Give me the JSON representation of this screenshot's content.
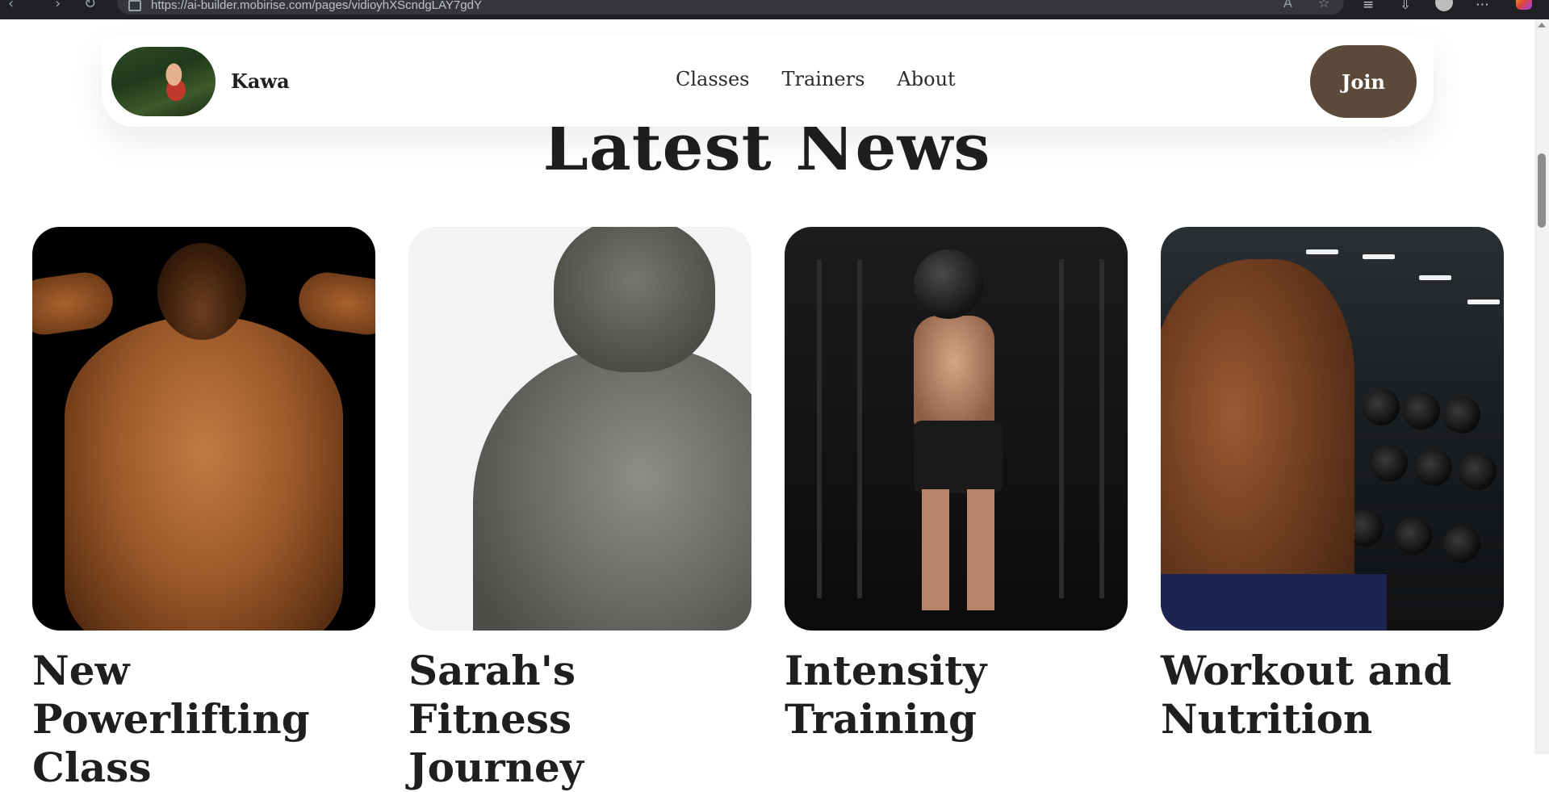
{
  "browser": {
    "url": "https://ai-builder.mobirise.com/pages/vidioyhXScndgLAY7gdY"
  },
  "header": {
    "brand_name": "Kawa",
    "nav": [
      "Classes",
      "Trainers",
      "About"
    ],
    "join_label": "Join"
  },
  "news": {
    "title": "Latest News",
    "cards": [
      {
        "title": "New Powerlifting Class"
      },
      {
        "title": "Sarah's Fitness Journey"
      },
      {
        "title": "Intensity Training"
      },
      {
        "title": "Workout and Nutrition"
      }
    ]
  },
  "colors": {
    "accent": "#5b4a3a",
    "text": "#1f1f1f",
    "background": "#ffffff"
  }
}
